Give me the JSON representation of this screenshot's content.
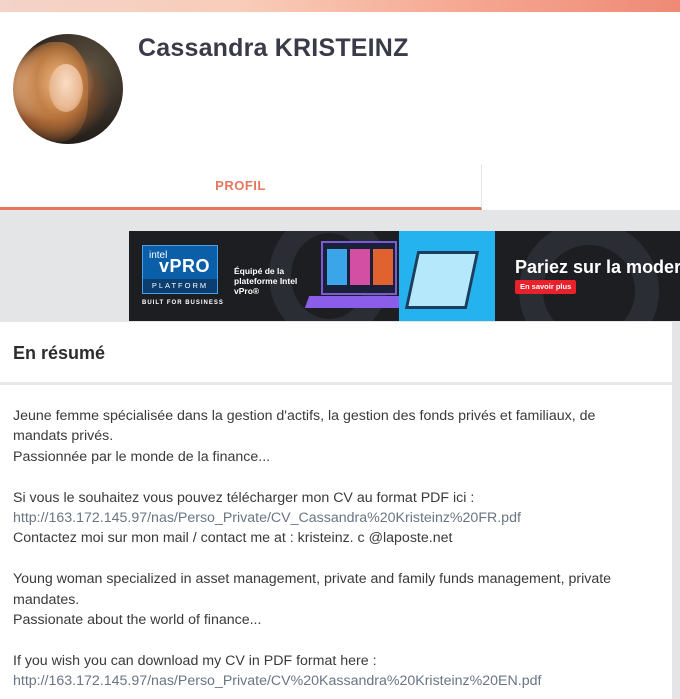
{
  "profile": {
    "name": "Cassandra KRISTEINZ",
    "avatar_alt": ""
  },
  "tabs": [
    {
      "label": "PROFIL",
      "active": true
    },
    {
      "label": "",
      "active": false
    }
  ],
  "ad": {
    "logo_intel": "intel",
    "logo_vpro": "vPRO",
    "logo_platform": "PLATFORM",
    "built": "BUILT FOR BUSINESS",
    "equipe": "Équipé de la plateforme Intel vPro®",
    "headline": "Pariez sur la modernité",
    "cta": "En savoir plus"
  },
  "resume": {
    "title": "En résumé",
    "fr_line1": "Jeune femme spécialisée dans la gestion d'actifs, la gestion des fonds privés et familiaux, de mandats privés.",
    "fr_line2": "Passionnée par le monde de la finance...",
    "fr_cv_text": "Si vous le souhaitez vous pouvez télécharger mon CV au format PDF ici : ",
    "fr_cv_link": "http://163.172.145.97/nas/Perso_Private/CV_Cassandra%20Kristeinz%20FR.pdf",
    "contact": "Contactez moi sur mon mail / contact me at : kristeinz. c @laposte.net",
    "en_line1": "Young woman specialized in asset management, private and family funds management, private mandates.",
    "en_line2": "Passionate about the world of finance...",
    "en_cv_text": "If you wish you can download my CV in PDF format here : ",
    "en_cv_link": "http://163.172.145.97/nas/Perso_Private/CV%20Kassandra%20Kristeinz%20EN.pdf"
  },
  "colors": {
    "accent": "#e8765d",
    "link": "#6a7583",
    "page_bg": "#e4e5e7"
  }
}
